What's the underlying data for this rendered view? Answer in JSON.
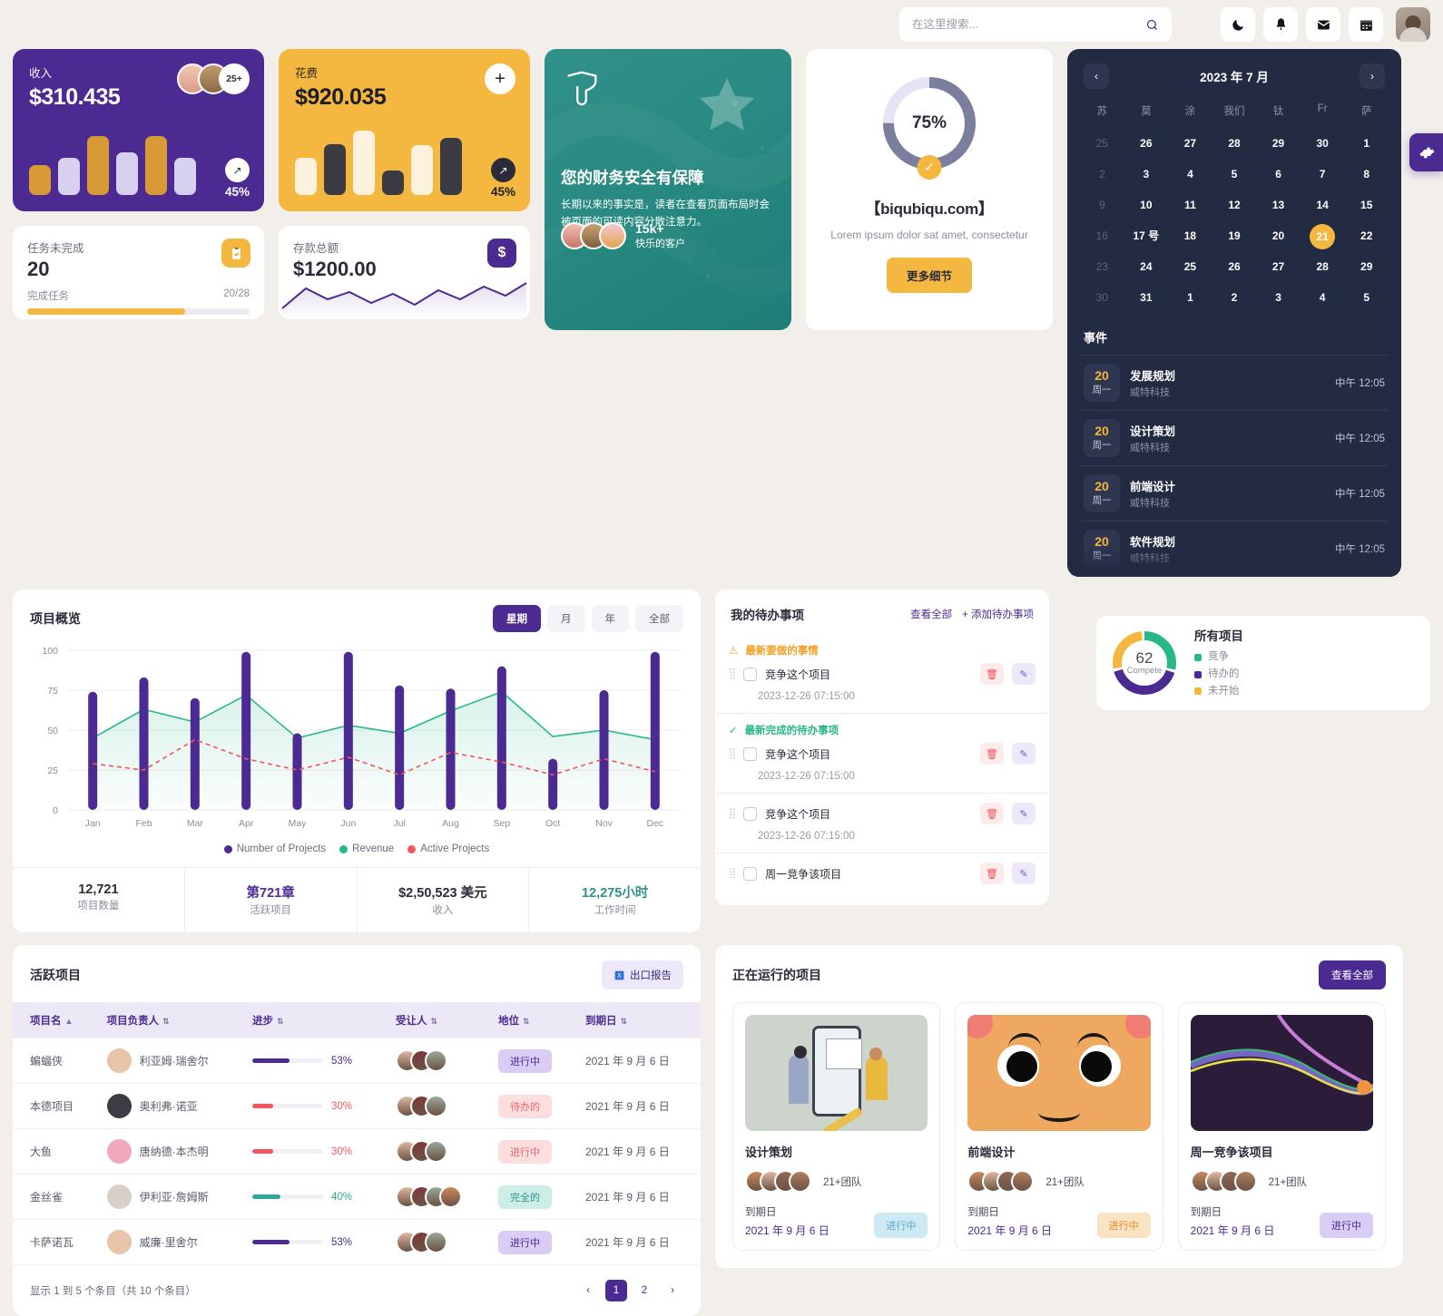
{
  "header": {
    "search_placeholder": "在这里搜索...",
    "icons": [
      "moon-icon",
      "bell-icon",
      "mail-icon",
      "calendar-icon"
    ],
    "avatar": "user-avatar"
  },
  "kpi": {
    "revenue": {
      "label": "收入",
      "value": "$310.435",
      "pct": "45%",
      "extra_count": "25+"
    },
    "expense": {
      "label": "花费",
      "value": "$920.035",
      "pct": "45%"
    }
  },
  "mini": {
    "tasks": {
      "label": "任务未完成",
      "value": "20",
      "sub_left": "完成任务",
      "sub_right": "20/28",
      "progress": 71
    },
    "savings": {
      "label": "存款总额",
      "value": "$1200.00",
      "icon": "dollar-icon"
    }
  },
  "promo": {
    "title": "您的财务安全有保障",
    "body": "长期以来的事实是，读者在查看页面布局时会被页面的可读内容分散注意力。",
    "count": "15k+",
    "caption": "快乐的客户"
  },
  "progress_card": {
    "percent": "75%",
    "brand": "【biqubiqu.com】",
    "desc": "Lorem ipsum dolor sat amet, consectetur",
    "button": "更多细节"
  },
  "calendar": {
    "title": "2023 年 7 月",
    "prev": "‹",
    "next": "›",
    "dow": [
      "苏",
      "莫",
      "涂",
      "我们",
      "钛",
      "Fr",
      "萨"
    ],
    "days": [
      {
        "n": "25",
        "mut": true
      },
      {
        "n": "26"
      },
      {
        "n": "27"
      },
      {
        "n": "28"
      },
      {
        "n": "29"
      },
      {
        "n": "30"
      },
      {
        "n": "1"
      },
      {
        "n": "2",
        "mut": true
      },
      {
        "n": "3"
      },
      {
        "n": "4"
      },
      {
        "n": "5"
      },
      {
        "n": "6"
      },
      {
        "n": "7"
      },
      {
        "n": "8"
      },
      {
        "n": "9",
        "mut": true
      },
      {
        "n": "10"
      },
      {
        "n": "11"
      },
      {
        "n": "12"
      },
      {
        "n": "13"
      },
      {
        "n": "14"
      },
      {
        "n": "15"
      },
      {
        "n": "16",
        "mut": true
      },
      {
        "n": "17 号"
      },
      {
        "n": "18"
      },
      {
        "n": "19"
      },
      {
        "n": "20"
      },
      {
        "n": "21",
        "today": true
      },
      {
        "n": "22"
      },
      {
        "n": "23",
        "mut": true
      },
      {
        "n": "24"
      },
      {
        "n": "25"
      },
      {
        "n": "26"
      },
      {
        "n": "27"
      },
      {
        "n": "28"
      },
      {
        "n": "29"
      },
      {
        "n": "30",
        "mut": true
      },
      {
        "n": "31"
      },
      {
        "n": "1"
      },
      {
        "n": "2"
      },
      {
        "n": "3"
      },
      {
        "n": "4"
      },
      {
        "n": "5"
      }
    ],
    "events_title": "事件",
    "events": [
      {
        "day": "20",
        "dow": "周一",
        "title": "发展规划",
        "org": "威特科技",
        "time": "中午 12:05"
      },
      {
        "day": "20",
        "dow": "周一",
        "title": "设计策划",
        "org": "威特科技",
        "time": "中午 12:05"
      },
      {
        "day": "20",
        "dow": "周一",
        "title": "前端设计",
        "org": "威特科技",
        "time": "中午 12:05"
      },
      {
        "day": "20",
        "dow": "周一",
        "title": "软件规划",
        "org": "威特科技",
        "time": "中午 12:05"
      }
    ]
  },
  "all_projects": {
    "title": "所有项目",
    "center_value": "62",
    "center_caption": "Compete",
    "legend": [
      {
        "label": "竞争",
        "color": "#27b888",
        "value": 30
      },
      {
        "label": "待办的",
        "color": "#4b2a91",
        "value": 42
      },
      {
        "label": "未开始",
        "color": "#f4b740",
        "value": 28
      }
    ]
  },
  "chart_panel": {
    "title": "项目概览",
    "tabs": [
      {
        "label": "星期",
        "active": true
      },
      {
        "label": "月",
        "active": false
      },
      {
        "label": "年",
        "active": false
      },
      {
        "label": "全部",
        "active": false
      }
    ],
    "stats": [
      {
        "value": "12,721",
        "label": "项目数量",
        "color": "#2b2b3a"
      },
      {
        "value": "第721章",
        "label": "活跃项目",
        "color": "#4b2a91"
      },
      {
        "value": "$2,50,523 美元",
        "label": "收入",
        "color": "#2b2b3a"
      },
      {
        "value": "12,275小时",
        "label": "工作时间",
        "color": "#2f9189"
      }
    ]
  },
  "chart_data": {
    "type": "bar",
    "title": "项目概览",
    "xlabel": "",
    "ylabel": "",
    "ylim": [
      0,
      100
    ],
    "yticks": [
      0,
      25,
      50,
      75,
      100
    ],
    "grid": true,
    "legend_position": "bottom",
    "categories": [
      "Jan",
      "Feb",
      "Mar",
      "Apr",
      "May",
      "Jun",
      "Jul",
      "Aug",
      "Sep",
      "Oct",
      "Nov",
      "Dec"
    ],
    "series": [
      {
        "name": "Number of Projects",
        "type": "bar",
        "color": "#4b2a91",
        "values": [
          74,
          83,
          70,
          99,
          48,
          99,
          78,
          76,
          90,
          32,
          75,
          99
        ]
      },
      {
        "name": "Revenue",
        "type": "area",
        "color": "#27b888",
        "values": [
          45,
          63,
          55,
          72,
          45,
          53,
          48,
          62,
          74,
          46,
          50,
          44
        ]
      },
      {
        "name": "Active Projects",
        "type": "line-dashed",
        "color": "#f4555c",
        "values": [
          29,
          25,
          44,
          32,
          25,
          33,
          22,
          36,
          30,
          22,
          32,
          24
        ]
      }
    ]
  },
  "todo": {
    "title": "我的待办事项",
    "see_all": "查看全部",
    "add": "+ 添加待办事项",
    "groups": [
      {
        "header": "最新要做的事情",
        "kind": "warn",
        "items": [
          {
            "text": "竞争这个项目",
            "time": "2023-12-26 07:15:00"
          }
        ]
      },
      {
        "header": "最新完成的待办事项",
        "kind": "ok",
        "items": [
          {
            "text": "竞争这个项目",
            "time": "2023-12-26 07:15:00"
          }
        ]
      },
      {
        "header": "",
        "kind": "none",
        "items": [
          {
            "text": "竞争这个项目",
            "time": "2023-12-26 07:15:00"
          }
        ]
      },
      {
        "header": "",
        "kind": "none",
        "items": [
          {
            "text": "周一竞争该项目",
            "time": ""
          }
        ]
      }
    ]
  },
  "table": {
    "title": "活跃项目",
    "export_label": "出口报告",
    "columns": [
      "项目名",
      "项目负责人",
      "进步",
      "受让人",
      "地位",
      "到期日"
    ],
    "rows": [
      {
        "name": "蝙蝠侠",
        "owner": "利亚姆·瑞舍尔",
        "avatar": "#e8c4a8",
        "progress": "53%",
        "bar": 53,
        "bar_color": "#4b2a91",
        "pct_color": "#4b2a91",
        "team": 3,
        "status": "进行中",
        "status_bg": "#d9ccf5",
        "status_fg": "#4b2a91",
        "due": "2021 年 9 月 6 日"
      },
      {
        "name": "本德项目",
        "owner": "奥利弗·诺亚",
        "avatar": "#3c3c44",
        "progress": "30%",
        "bar": 30,
        "bar_color": "#f4555c",
        "pct_color": "#f4555c",
        "team": 3,
        "status": "待办的",
        "status_bg": "#fcdede",
        "status_fg": "#e8656c",
        "due": "2021 年 9 月 6 日"
      },
      {
        "name": "大鱼",
        "owner": "唐纳德·本杰明",
        "avatar": "#f0a8bc",
        "progress": "30%",
        "bar": 30,
        "bar_color": "#f4555c",
        "pct_color": "#f4555c",
        "team": 3,
        "status": "进行中",
        "status_bg": "#fcdede",
        "status_fg": "#e8656c",
        "due": "2021 年 9 月 6 日"
      },
      {
        "name": "金丝雀",
        "owner": "伊利亚·詹姆斯",
        "avatar": "#d8d0c6",
        "progress": "40%",
        "bar": 40,
        "bar_color": "#2fa89a",
        "pct_color": "#2fa89a",
        "team": 4,
        "status": "完全的",
        "status_bg": "#cdeee6",
        "status_fg": "#2f9189",
        "due": "2021 年 9 月 6 日"
      },
      {
        "name": "卡萨诺瓦",
        "owner": "威廉·里舍尔",
        "avatar": "#e8c4a8",
        "progress": "53%",
        "bar": 53,
        "bar_color": "#4b2a91",
        "pct_color": "#4b2a91",
        "team": 3,
        "status": "进行中",
        "status_bg": "#d9ccf5",
        "status_fg": "#4b2a91",
        "due": "2021 年 9 月 6 日"
      }
    ],
    "footer": "显示 1 到 5 个条目（共 10 个条目）",
    "pager": {
      "prev": "‹",
      "pages": [
        "1",
        "2"
      ],
      "current": "1",
      "next": "›"
    }
  },
  "running": {
    "title": "正在运行的项目",
    "see_all": "查看全部",
    "cards": [
      {
        "name": "设计策划",
        "team": "21+团队",
        "due_label": "到期日",
        "due": "2021 年 9 月 6 日",
        "status": "进行中",
        "status_bg": "#cde9f4",
        "status_fg": "#5aa6c8",
        "thumb": "design-illustration"
      },
      {
        "name": "前端设计",
        "team": "21+团队",
        "due_label": "到期日",
        "due": "2021 年 9 月 6 日",
        "status": "进行中",
        "status_bg": "#fae3c2",
        "status_fg": "#e08a2a",
        "thumb": "face-illustration"
      },
      {
        "name": "周一竞争该项目",
        "team": "21+团队",
        "due_label": "到期日",
        "due": "2021 年 9 月 6 日",
        "status": "进行中",
        "status_bg": "#d9ccf5",
        "status_fg": "#4b2a91",
        "thumb": "abstract-lines"
      }
    ]
  },
  "settings_button": "gear-icon"
}
